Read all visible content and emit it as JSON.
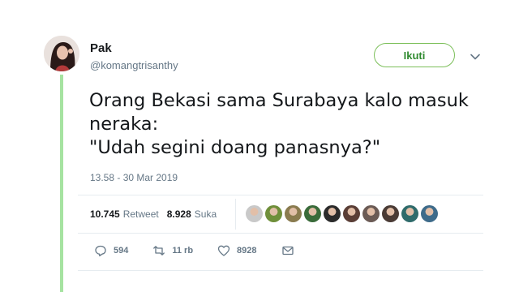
{
  "user": {
    "display_name": "Pak",
    "handle": "@komangtrisanthy",
    "avatar_icon": "profile-photo"
  },
  "follow_button": {
    "label": "Ikuti"
  },
  "tweet": {
    "text": "Orang Bekasi sama Surabaya kalo masuk\nneraka:\n\"Udah segini doang panasnya?\"",
    "timestamp": "13.58 - 30 Mar 2019"
  },
  "stats": {
    "retweets": {
      "count": "10.745",
      "label": "Retweet"
    },
    "likes": {
      "count": "8.928",
      "label": "Suka"
    }
  },
  "likers": [
    {
      "color": "#c9c9c9"
    },
    {
      "color": "#6f8f3a"
    },
    {
      "color": "#8a7b4f"
    },
    {
      "color": "#3a6b3a"
    },
    {
      "color": "#2b2b2b"
    },
    {
      "color": "#5a3e36"
    },
    {
      "color": "#6b5b55"
    },
    {
      "color": "#4a3b35"
    },
    {
      "color": "#2f6b6b"
    },
    {
      "color": "#3e6b8a"
    }
  ],
  "actions": {
    "reply": {
      "count": "594",
      "icon": "reply-icon"
    },
    "retweet": {
      "count": "11 rb",
      "icon": "retweet-icon"
    },
    "like": {
      "count": "8928",
      "icon": "heart-icon"
    },
    "message": {
      "icon": "envelope-icon"
    }
  },
  "colors": {
    "accent_green": "#7cbf5a",
    "thread_line": "#a6e3a1",
    "muted_text": "#657786"
  }
}
